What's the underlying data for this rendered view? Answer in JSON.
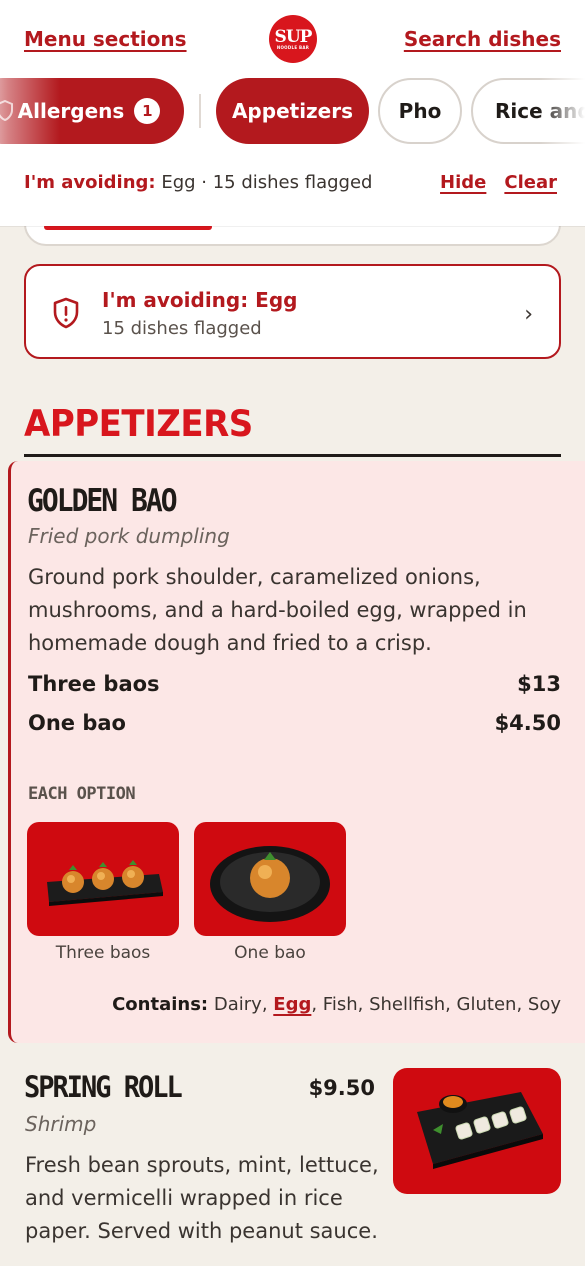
{
  "header": {
    "menu_sections": "Menu sections",
    "search_dishes": "Search dishes",
    "logo_text": "SUP",
    "logo_sub": "NOODLE BAR"
  },
  "chips": {
    "allergens": "Allergens",
    "allergens_count": "1",
    "appetizers": "Appetizers",
    "pho": "Pho",
    "rice": "Rice and"
  },
  "avoid_bar": {
    "label": "I'm avoiding:",
    "summary": " Egg · 15 dishes flagged",
    "hide": "Hide",
    "clear": "Clear"
  },
  "avoid_card": {
    "title": "I'm avoiding: Egg",
    "subtitle": "15 dishes flagged"
  },
  "section": {
    "title": "APPETIZERS"
  },
  "item1": {
    "name": "GOLDEN BAO",
    "subtitle": "Fried pork dumpling",
    "description": "Ground pork shoulder, caramelized onions, mushrooms, and a hard-boiled egg, wrapped in homemade dough and fried to a crisp.",
    "prices": [
      {
        "label": "Three baos",
        "price": "$13"
      },
      {
        "label": "One bao",
        "price": "$4.50"
      }
    ],
    "each_option": "EACH OPTION",
    "options": [
      "Three baos",
      "One bao"
    ],
    "contains_label": "Contains:",
    "contains_pre": "Dairy,",
    "contains_egg": "Egg",
    "contains_post": ", Fish, Shellfish, Gluten, Soy"
  },
  "item2": {
    "name": "SPRING ROLL",
    "price": "$9.50",
    "subtitle": "Shrimp",
    "description": "Fresh bean sprouts, mint, lettuce, and vermicelli wrapped in rice paper. Served with peanut sauce."
  },
  "colors": {
    "brand_red": "#d8161d",
    "dark_red": "#b3191e",
    "highlight_bg": "#fce7e6",
    "page_bg": "#f3efe8"
  }
}
